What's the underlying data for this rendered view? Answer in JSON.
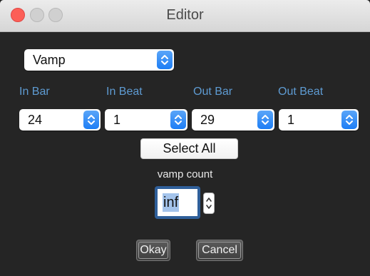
{
  "window": {
    "title": "Editor"
  },
  "mode_select": {
    "value": "Vamp"
  },
  "columns": [
    {
      "label": "In Bar",
      "value": "24"
    },
    {
      "label": "In Beat",
      "value": "1"
    },
    {
      "label": "Out Bar",
      "value": "29"
    },
    {
      "label": "Out Beat",
      "value": "1"
    }
  ],
  "select_all_label": "Select All",
  "vamp": {
    "label": "vamp count",
    "value": "inf"
  },
  "buttons": {
    "okay": "Okay",
    "cancel": "Cancel"
  },
  "colors": {
    "accent": "#1d7ef5",
    "column_label": "#5e9bd2",
    "close": "#fc5f57"
  }
}
